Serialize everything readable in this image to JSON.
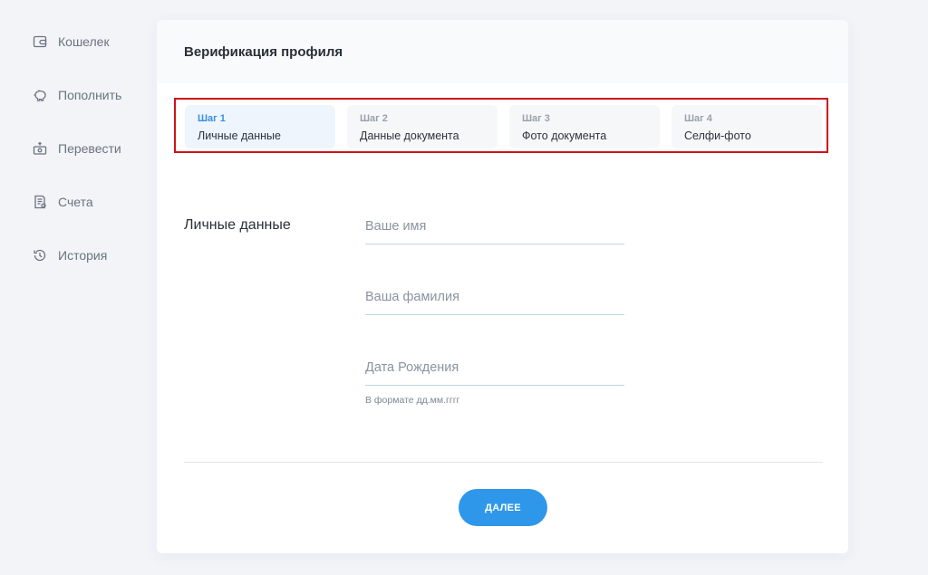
{
  "sidebar": {
    "items": [
      {
        "label": "Кошелек",
        "icon": "wallet-icon"
      },
      {
        "label": "Пополнить",
        "icon": "piggy-bank-icon"
      },
      {
        "label": "Перевести",
        "icon": "money-transfer-icon"
      },
      {
        "label": "Счета",
        "icon": "invoice-icon"
      },
      {
        "label": "История",
        "icon": "history-icon"
      }
    ]
  },
  "card": {
    "title": "Верификация профиля"
  },
  "steps": [
    {
      "number": "Шаг 1",
      "label": "Личные данные",
      "active": true
    },
    {
      "number": "Шаг 2",
      "label": "Данные документа",
      "active": false
    },
    {
      "number": "Шаг 3",
      "label": "Фото документа",
      "active": false
    },
    {
      "number": "Шаг 4",
      "label": "Селфи-фото",
      "active": false
    }
  ],
  "form": {
    "section_title": "Личные данные",
    "first_name": {
      "value": "",
      "placeholder": "Ваше имя"
    },
    "last_name": {
      "value": "",
      "placeholder": "Ваша фамилия"
    },
    "birth_date": {
      "value": "",
      "placeholder": "Дата Рождения",
      "hint": "В формате дд.мм.гггг"
    }
  },
  "actions": {
    "next_label": "ДАЛЕЕ"
  },
  "colors": {
    "accent": "#2f97ea",
    "active_step_bg": "#eef5fd",
    "highlight_frame": "#d0101b"
  }
}
